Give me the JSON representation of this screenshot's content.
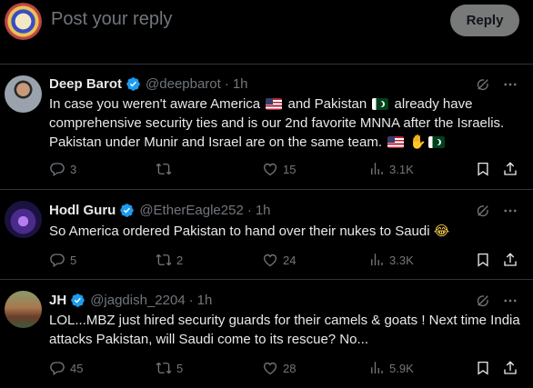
{
  "composer": {
    "placeholder": "Post your reply",
    "reply_label": "Reply"
  },
  "tweets": [
    {
      "name": "Deep Barot",
      "handle": "@deepbarot",
      "time": "1h",
      "text_parts": [
        "In case you weren't aware America ",
        " and Pakistan ",
        " already have comprehensive security ties and is our 2nd favorite MNNA after the Israelis. Pakistan under Munir and Israel are on the same team. "
      ],
      "replies": "3",
      "reposts": "",
      "likes": "15",
      "views": "3.1K"
    },
    {
      "name": "Hodl Guru",
      "handle": "@EtherEagle252",
      "time": "1h",
      "text": "So America ordered Pakistan to hand over their nukes to Saudi ",
      "emoji": "😂",
      "replies": "5",
      "reposts": "2",
      "likes": "24",
      "views": "3.3K"
    },
    {
      "name": "JH",
      "handle": "@jagdish_2204",
      "time": "1h",
      "text": "LOL...MBZ just hired security guards for their camels & goats ! Next time India attacks Pakistan, will Saudi come to its rescue? No...",
      "replies": "45",
      "reposts": "5",
      "likes": "28",
      "views": "5.9K"
    }
  ],
  "separator": "·",
  "colors": {
    "background": "#000000",
    "text": "#e7e9ea",
    "muted": "#71767b",
    "verified": "#1d9bf0",
    "reply_button": "#787a7a"
  },
  "icons": [
    "grok-icon",
    "more-icon",
    "reply-icon",
    "repost-icon",
    "like-icon",
    "views-icon",
    "bookmark-icon",
    "share-icon",
    "verified-badge-icon"
  ]
}
